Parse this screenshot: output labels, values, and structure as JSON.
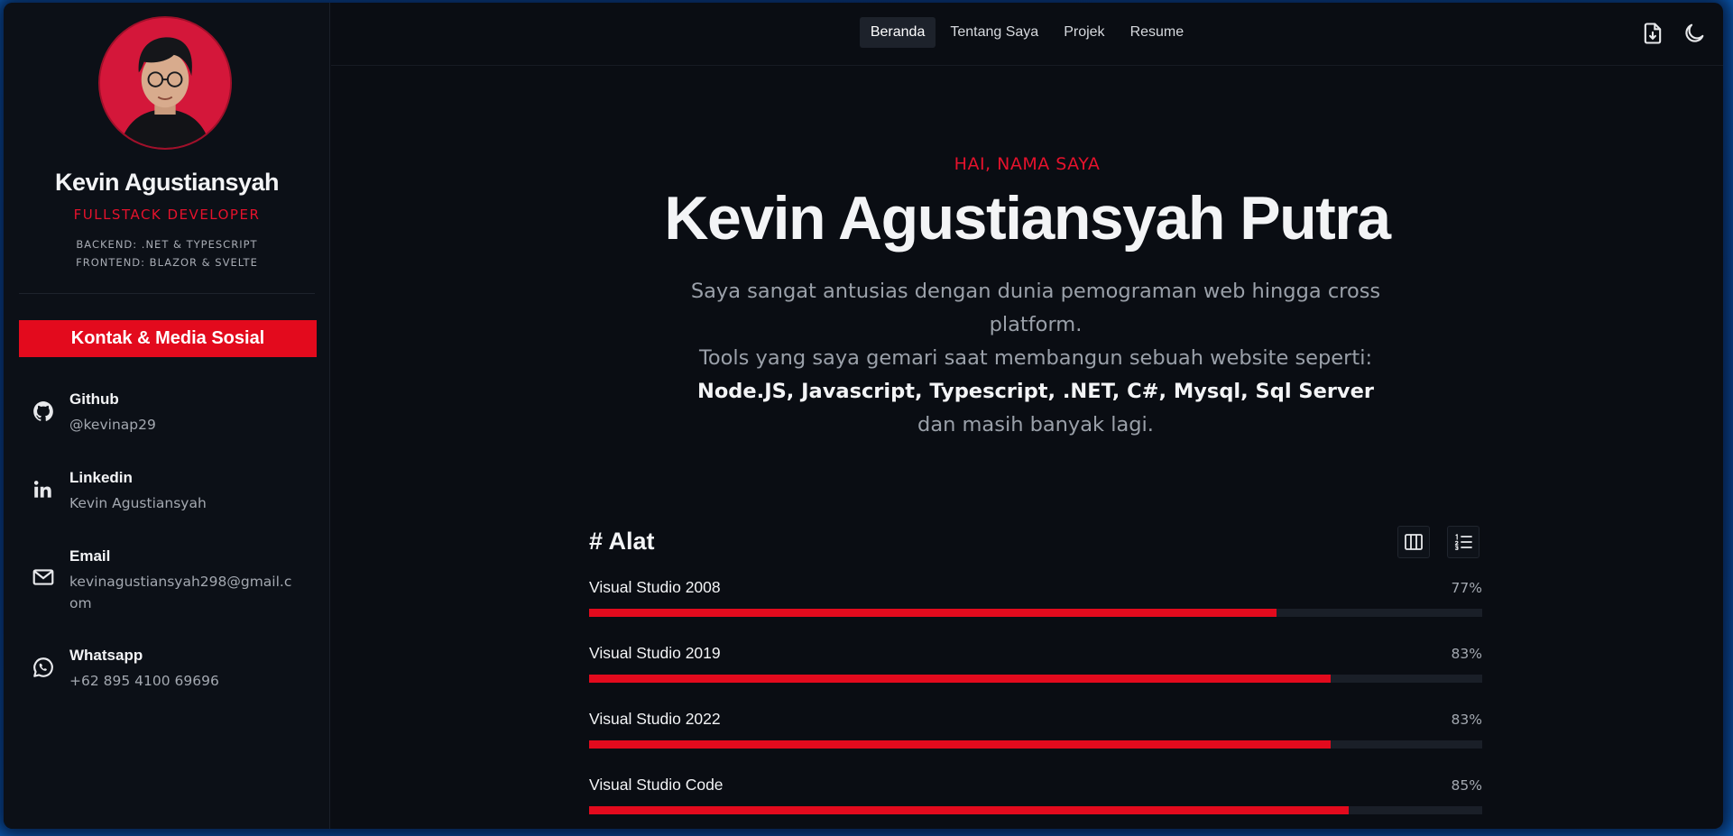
{
  "sidebar": {
    "name": "Kevin Agustiansyah",
    "role": "FULLSTACK DEVELOPER",
    "stack_backend": "BACKEND: .NET & TYPESCRIPT",
    "stack_frontend": "FRONTEND: BLAZOR & SVELTE",
    "contact_header": "Kontak & Media Sosial",
    "contacts": [
      {
        "title": "Github",
        "value": "@kevinap29",
        "icon": "github-icon"
      },
      {
        "title": "Linkedin",
        "value": "Kevin Agustiansyah",
        "icon": "linkedin-icon"
      },
      {
        "title": "Email",
        "value": "kevinagustiansyah298@gmail.com",
        "icon": "mail-icon"
      },
      {
        "title": "Whatsapp",
        "value": "+62 895 4100 69696",
        "icon": "whatsapp-icon"
      }
    ]
  },
  "nav": {
    "items": [
      "Beranda",
      "Tentang Saya",
      "Projek",
      "Resume"
    ],
    "active": "Beranda",
    "right_icons": [
      "download-file-icon",
      "moon-icon"
    ]
  },
  "hero": {
    "greeting": "HAI, NAMA SAYA",
    "headline": "Kevin Agustiansyah Putra",
    "intro_line1": "Saya sangat antusias dengan dunia pemograman web hingga cross platform.",
    "intro_line2": "Tools yang saya gemari saat membangun sebuah website seperti:",
    "intro_tools": "Node.JS, Javascript, Typescript, .NET, C#, Mysql, Sql Server",
    "intro_tail": "dan masih banyak lagi."
  },
  "tools": {
    "title": "# Alat",
    "view_icons": [
      "columns-icon",
      "ordered-list-icon"
    ],
    "items": [
      {
        "name": "Visual Studio 2008",
        "percent_label": "77%",
        "percent": 77
      },
      {
        "name": "Visual Studio 2019",
        "percent_label": "83%",
        "percent": 83
      },
      {
        "name": "Visual Studio 2022",
        "percent_label": "83%",
        "percent": 83
      },
      {
        "name": "Visual Studio Code",
        "percent_label": "85%",
        "percent": 85
      }
    ]
  },
  "colors": {
    "accent": "#e30a1d",
    "background": "#0a0d13",
    "sidebar": "#0c1017",
    "frame": "#0a58ad"
  }
}
